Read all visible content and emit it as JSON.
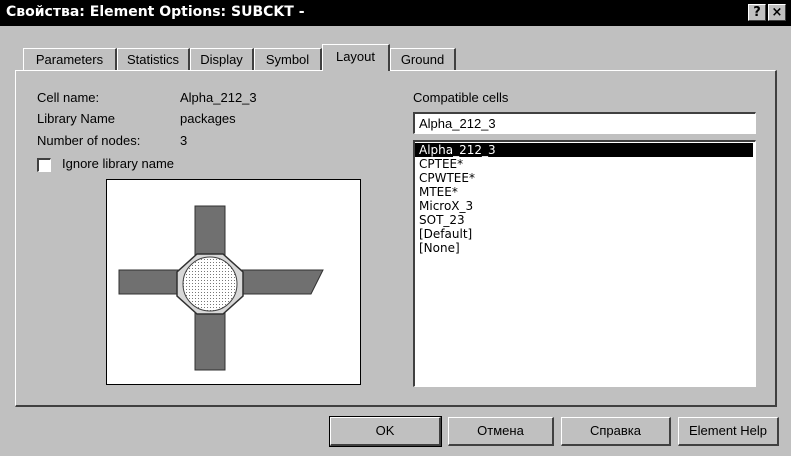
{
  "window": {
    "title": "Свойства: Element Options: SUBCKT -",
    "help_glyph": "?",
    "close_glyph": "×"
  },
  "tabs": [
    {
      "label": "Parameters"
    },
    {
      "label": "Statistics"
    },
    {
      "label": "Display"
    },
    {
      "label": "Symbol"
    },
    {
      "label": "Layout",
      "active": true
    },
    {
      "label": "Ground"
    }
  ],
  "info": {
    "cell_name_label": "Cell name:",
    "cell_name_value": "Alpha_212_3",
    "library_label": "Library Name",
    "library_value": "packages",
    "nodes_label": "Number of nodes:",
    "nodes_value": "3",
    "ignore_label": "Ignore library name",
    "ignore_checked": false
  },
  "compatible": {
    "label": "Compatible cells",
    "value": "Alpha_212_3",
    "items": [
      "Alpha_212_3",
      "CPTEE*",
      "CPWTEE*",
      "MTEE*",
      "MicroX_3",
      "SOT_23",
      "[Default]",
      "[None]"
    ],
    "selected": "Alpha_212_3"
  },
  "buttons": {
    "ok": "OK",
    "cancel": "Отмена",
    "help": "Справка",
    "element_help": "Element Help"
  },
  "colors": {
    "dialog_bg": "#c0c0c0",
    "titlebar_bg": "#000000",
    "selection_bg": "#000000",
    "pad_fill": "#707070"
  }
}
